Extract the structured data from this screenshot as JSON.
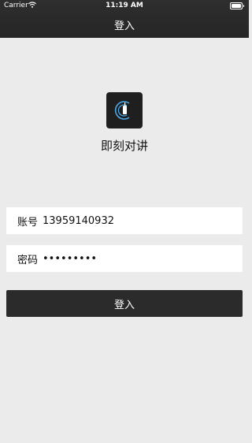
{
  "status_bar": {
    "carrier": "Carrier",
    "time": "11:19 AM"
  },
  "nav": {
    "title": "登入"
  },
  "app": {
    "name": "即刻对讲",
    "logo_icon": "walkie-talkie-icon"
  },
  "form": {
    "account_label": "账号",
    "account_value": "13959140932",
    "password_label": "密码",
    "password_value": "•••••••••",
    "login_button": "登入"
  },
  "colors": {
    "bar": "#2e2e2e",
    "background": "#ebebeb",
    "accent": "#4aa8e8",
    "button": "#2b2b2b"
  }
}
